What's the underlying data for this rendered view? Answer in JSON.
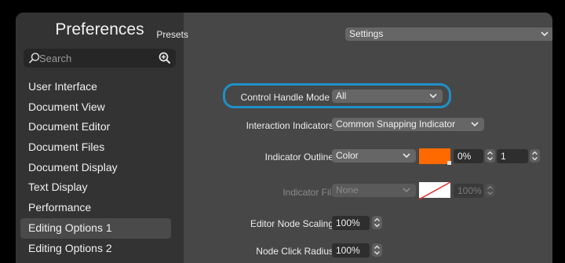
{
  "sidebar": {
    "title": "Preferences",
    "search_placeholder": "Search",
    "items": [
      {
        "label": "User Interface"
      },
      {
        "label": "Document View"
      },
      {
        "label": "Document Editor"
      },
      {
        "label": "Document Files"
      },
      {
        "label": "Document Display"
      },
      {
        "label": "Text Display"
      },
      {
        "label": "Performance"
      },
      {
        "label": "Editing Options 1",
        "selected": true
      },
      {
        "label": "Editing Options 2"
      }
    ]
  },
  "main": {
    "presets": {
      "label": "Presets",
      "value": "Settings"
    },
    "control_handle_mode": {
      "label": "Control Handle Mode",
      "value": "All",
      "focused": true
    },
    "interaction_indicators": {
      "label": "Interaction Indicators",
      "value": "Common Snapping Indicator"
    },
    "indicator_outline": {
      "label": "Indicator Outline",
      "type": "Color",
      "color": "#ff6a00",
      "opacity": "0%",
      "width": "1"
    },
    "indicator_fill": {
      "label": "Indicator Fill",
      "type": "None",
      "opacity": "100%",
      "disabled": true
    },
    "editor_node_scaling": {
      "label": "Editor Node Scaling",
      "value": "100%"
    },
    "node_click_radius": {
      "label": "Node Click Radius",
      "value": "100%"
    }
  },
  "colors": {
    "focus_ring": "#1f8fc6",
    "outline_color": "#ff6a00",
    "fill_swatch": "#ffffff",
    "fill_slash": "#e03030"
  },
  "icons": [
    "magnifier-icon",
    "zoom-search-icon",
    "chevron-down-icon",
    "stepper-icon"
  ]
}
